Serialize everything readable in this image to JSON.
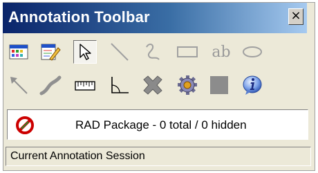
{
  "window": {
    "title": "Annotation Toolbar",
    "close_label": "×"
  },
  "toolbar": {
    "row1": [
      {
        "name": "palette-icon"
      },
      {
        "name": "edit-note-icon"
      },
      {
        "name": "pointer-arrow-icon",
        "selected": true
      },
      {
        "name": "line-tool-icon"
      },
      {
        "name": "freehand-tool-icon"
      },
      {
        "name": "rectangle-tool-icon"
      },
      {
        "name": "text-tool-icon",
        "label": "ab"
      },
      {
        "name": "ellipse-tool-icon"
      }
    ],
    "row2": [
      {
        "name": "arrow-tool-icon"
      },
      {
        "name": "curve-tool-icon"
      },
      {
        "name": "ruler-tool-icon"
      },
      {
        "name": "angle-tool-icon"
      },
      {
        "name": "delete-icon"
      },
      {
        "name": "settings-gear-icon"
      },
      {
        "name": "gray-square-icon"
      },
      {
        "name": "info-icon"
      }
    ]
  },
  "package": {
    "status_text": "RAD Package - 0 total / 0 hidden",
    "icon": "no-entry-icon",
    "icon_color": "#cc0000"
  },
  "statusbar": {
    "text": "Current Annotation Session"
  }
}
